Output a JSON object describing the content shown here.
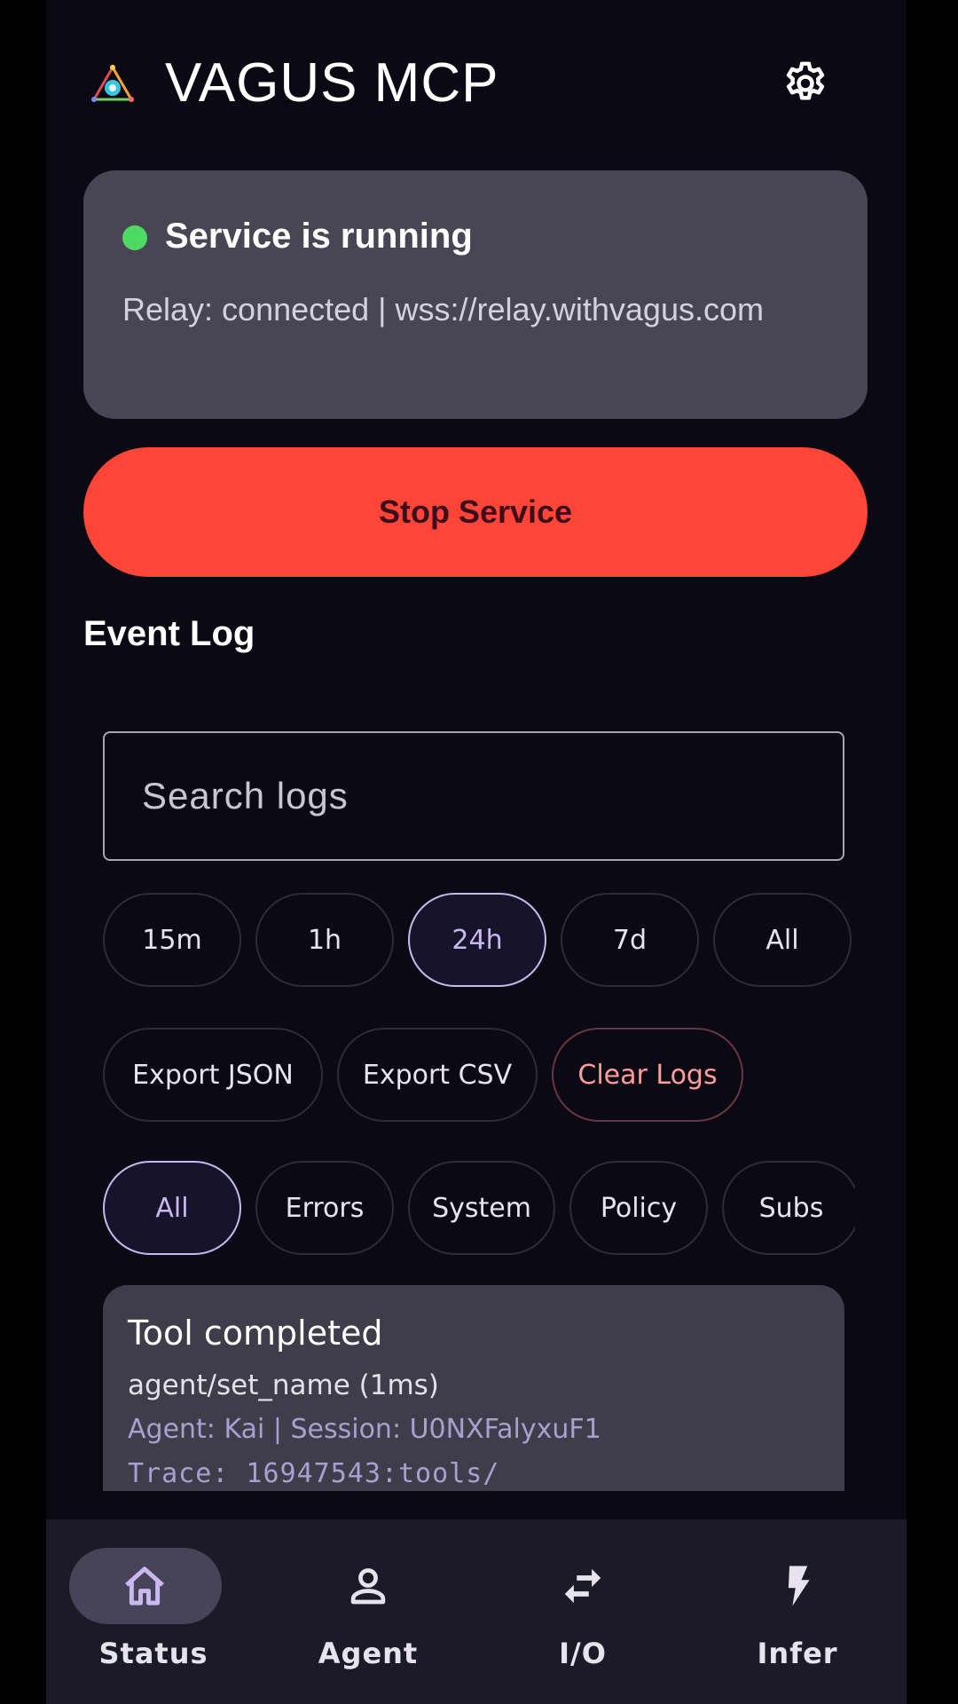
{
  "app": {
    "title": "VAGUS MCP",
    "logo_icon": "vagus-logo-icon",
    "settings_icon": "gear-icon"
  },
  "status": {
    "title": "Service is running",
    "detail": "Relay: connected | wss://relay.withvagus.com",
    "indicator_color": "#4cd964"
  },
  "stop_button": {
    "label": "Stop Service",
    "color": "#ff4538"
  },
  "event_log": {
    "title": "Event Log",
    "search_placeholder": "Search logs",
    "search_value": "",
    "time_ranges": [
      {
        "label": "15m",
        "selected": false
      },
      {
        "label": "1h",
        "selected": false
      },
      {
        "label": "24h",
        "selected": true
      },
      {
        "label": "7d",
        "selected": false
      },
      {
        "label": "All",
        "selected": false
      }
    ],
    "actions": [
      {
        "label": "Export JSON"
      },
      {
        "label": "Export CSV"
      },
      {
        "label": "Clear Logs"
      }
    ],
    "categories": [
      {
        "label": "All",
        "selected": true
      },
      {
        "label": "Errors",
        "selected": false
      },
      {
        "label": "System",
        "selected": false
      },
      {
        "label": "Policy",
        "selected": false
      },
      {
        "label": "Subs",
        "selected": false
      }
    ],
    "entries": [
      {
        "title": "Tool completed",
        "tool": "agent/set_name (1ms)",
        "meta": "Agent: Kai | Session: U0NXFalyxuF1",
        "trace": "Trace: 16947543:tools/"
      }
    ]
  },
  "nav": {
    "items": [
      {
        "label": "Status",
        "icon": "home-icon",
        "active": true
      },
      {
        "label": "Agent",
        "icon": "person-icon",
        "active": false
      },
      {
        "label": "I/O",
        "icon": "swap-arrows-icon",
        "active": false
      },
      {
        "label": "Infer",
        "icon": "lightning-icon",
        "active": false
      }
    ],
    "active_pill_color": "#474459",
    "active_icon_color": "#c9b9f0"
  }
}
